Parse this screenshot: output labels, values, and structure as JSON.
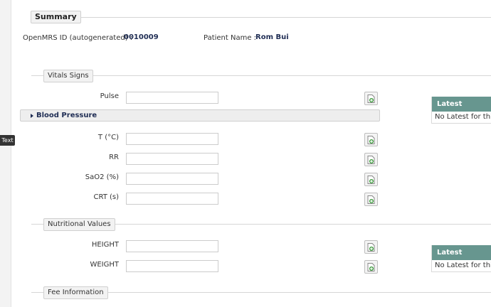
{
  "sidebar": {
    "tooltip": "Text"
  },
  "summary": {
    "legend": "Summary",
    "id_label": "OpenMRS ID (autogenerated) :",
    "id_value": "0010009",
    "name_label": "Patient Name :",
    "name_value": "Rom Bui"
  },
  "vitals": {
    "legend": "Vitals Signs",
    "pulse": "Pulse",
    "blood_pressure": "Blood Pressure",
    "temp": "T (°C)",
    "rr": "RR",
    "sao2": "SaO2 (%)",
    "crt": "CRT (s)"
  },
  "nutrition": {
    "legend": "Nutritional Values",
    "height": "HEIGHT",
    "weight": "WEIGHT"
  },
  "fee": {
    "legend": "Fee Information"
  },
  "latest": {
    "title": "Latest",
    "empty": "No Latest for this"
  },
  "colors": {
    "latest_header": "#67968f",
    "value_text": "#1f2d54",
    "add_icon": "#3a9a3a"
  },
  "icons": {
    "add": "add-document-icon",
    "expand": "caret-right-icon"
  }
}
